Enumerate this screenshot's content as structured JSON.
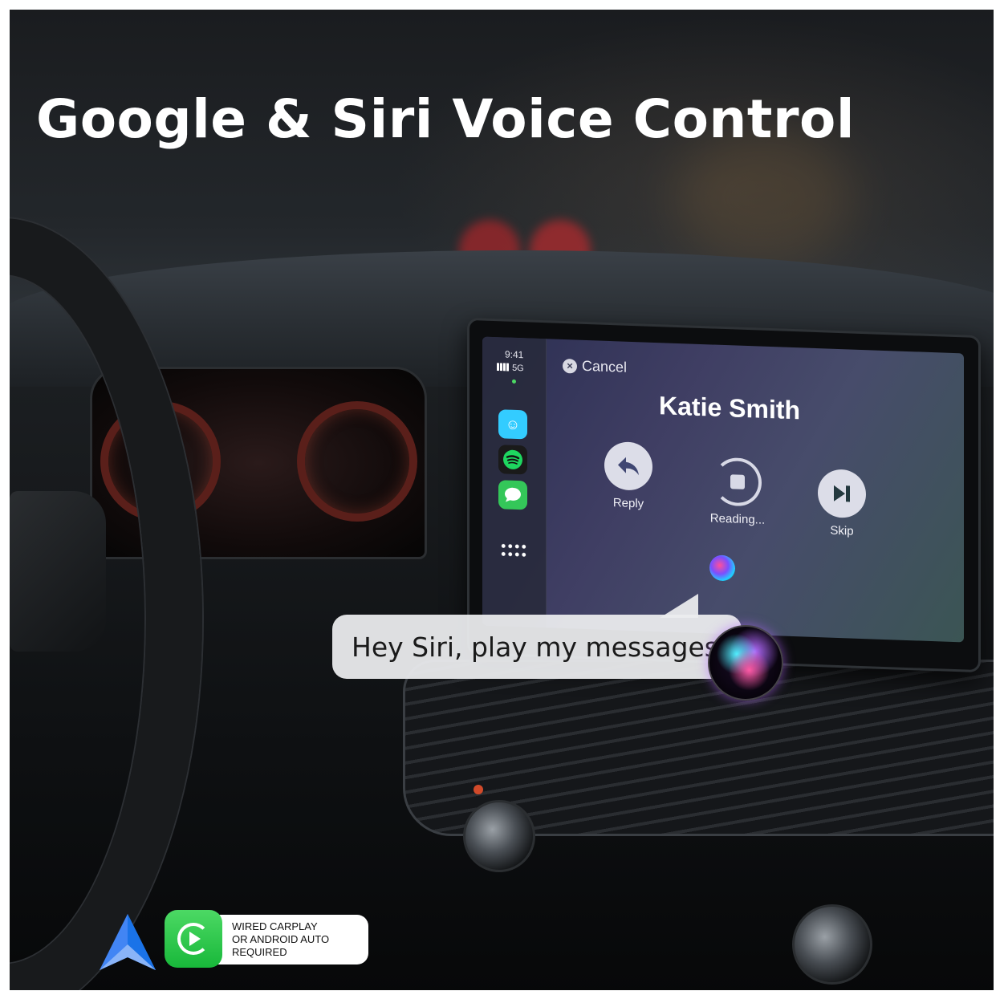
{
  "headline": "Google & Siri Voice Control",
  "carplay_screen": {
    "status": {
      "time": "9:41",
      "network": "5G"
    },
    "dock_apps": [
      "waze-icon",
      "spotify-icon",
      "messages-icon",
      "app-grid-icon"
    ],
    "cancel_label": "Cancel",
    "contact_name": "Katie Smith",
    "actions": {
      "reply": "Reply",
      "reading": "Reading...",
      "skip": "Skip"
    }
  },
  "voice_bubble": {
    "text": "Hey Siri, play my messages"
  },
  "badge": {
    "line1": "WIRED CARPLAY",
    "line2": "OR ANDROID AUTO",
    "line3": "REQUIRED"
  },
  "colors": {
    "carplay_green": "#34c759",
    "android_auto_blue": "#4285f4",
    "siri_pink": "#ff5aa5",
    "siri_cyan": "#4ff0ff"
  }
}
